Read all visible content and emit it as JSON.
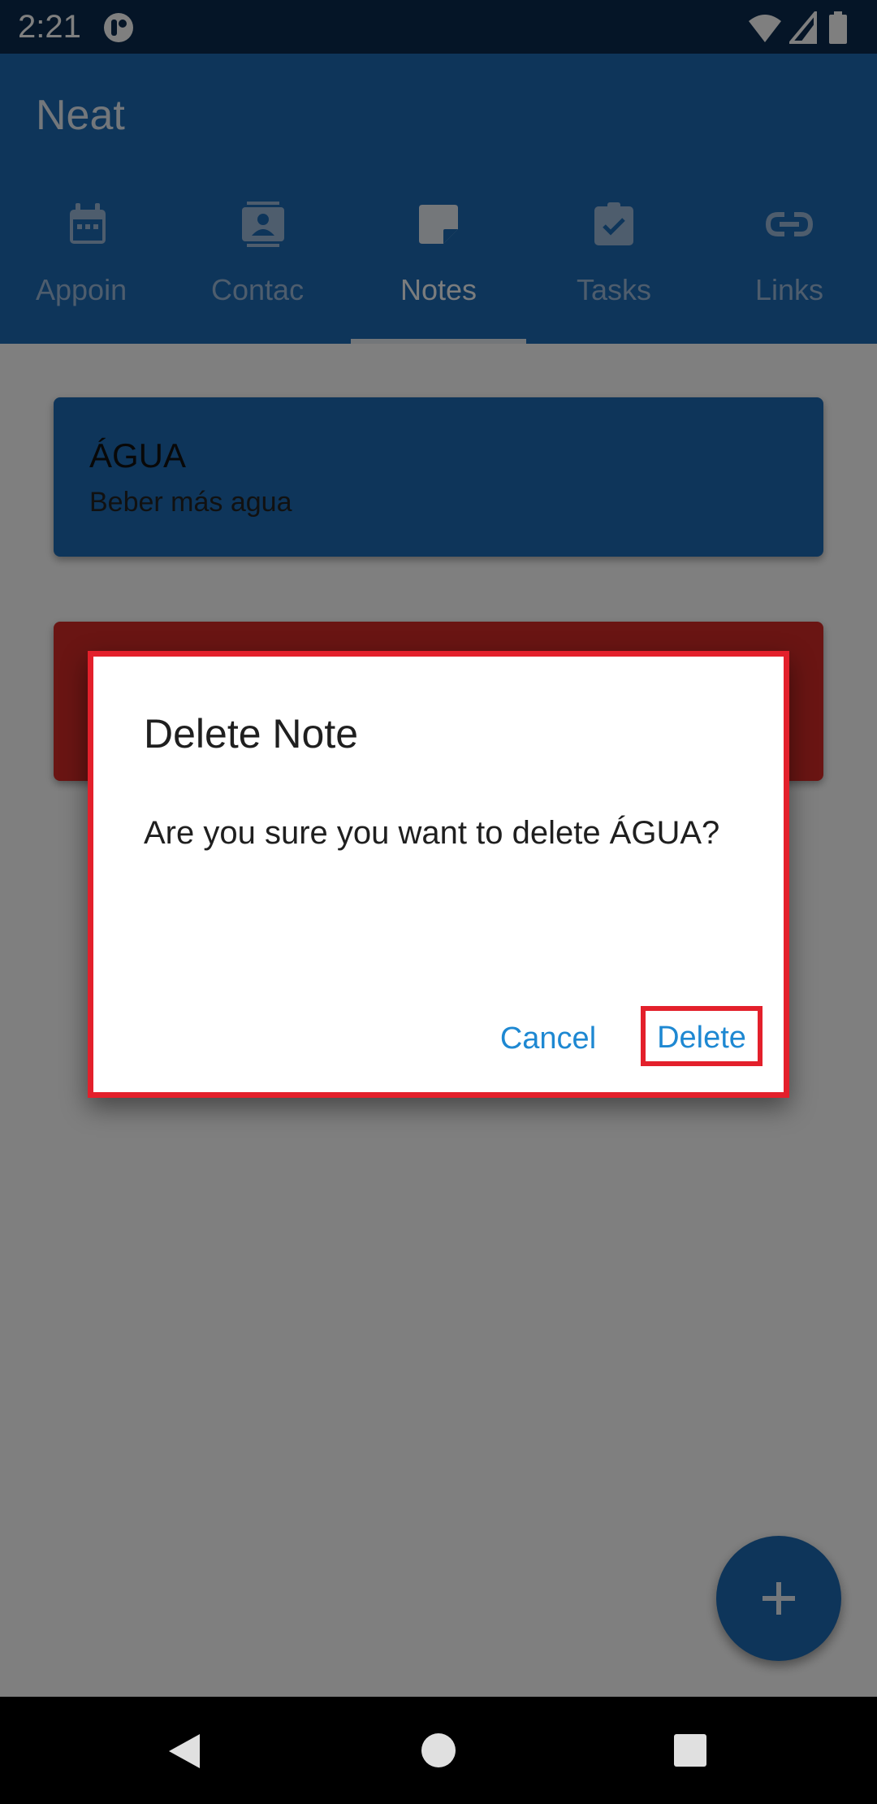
{
  "status_bar": {
    "time": "2:21"
  },
  "app": {
    "title": "Neat",
    "colors": {
      "primary": "#1d6ab4",
      "accent": "#1e88d2",
      "danger": "#d42a26",
      "highlight": "#e3202b"
    }
  },
  "tabs": [
    {
      "label": "Appoin",
      "icon": "calendar-icon"
    },
    {
      "label": "Contac",
      "icon": "contacts-icon"
    },
    {
      "label": "Notes",
      "icon": "note-icon",
      "active": true
    },
    {
      "label": "Tasks",
      "icon": "task-check-icon"
    },
    {
      "label": "Links",
      "icon": "link-icon"
    }
  ],
  "notes": [
    {
      "title": "ÁGUA",
      "body": "Beber más agua"
    },
    {
      "title": "",
      "body": ""
    }
  ],
  "dialog": {
    "title": "Delete Note",
    "message": "Are you sure you want to delete ÁGUA?",
    "cancel_label": "Cancel",
    "delete_label": "Delete"
  },
  "fab": {
    "icon": "plus-icon"
  }
}
